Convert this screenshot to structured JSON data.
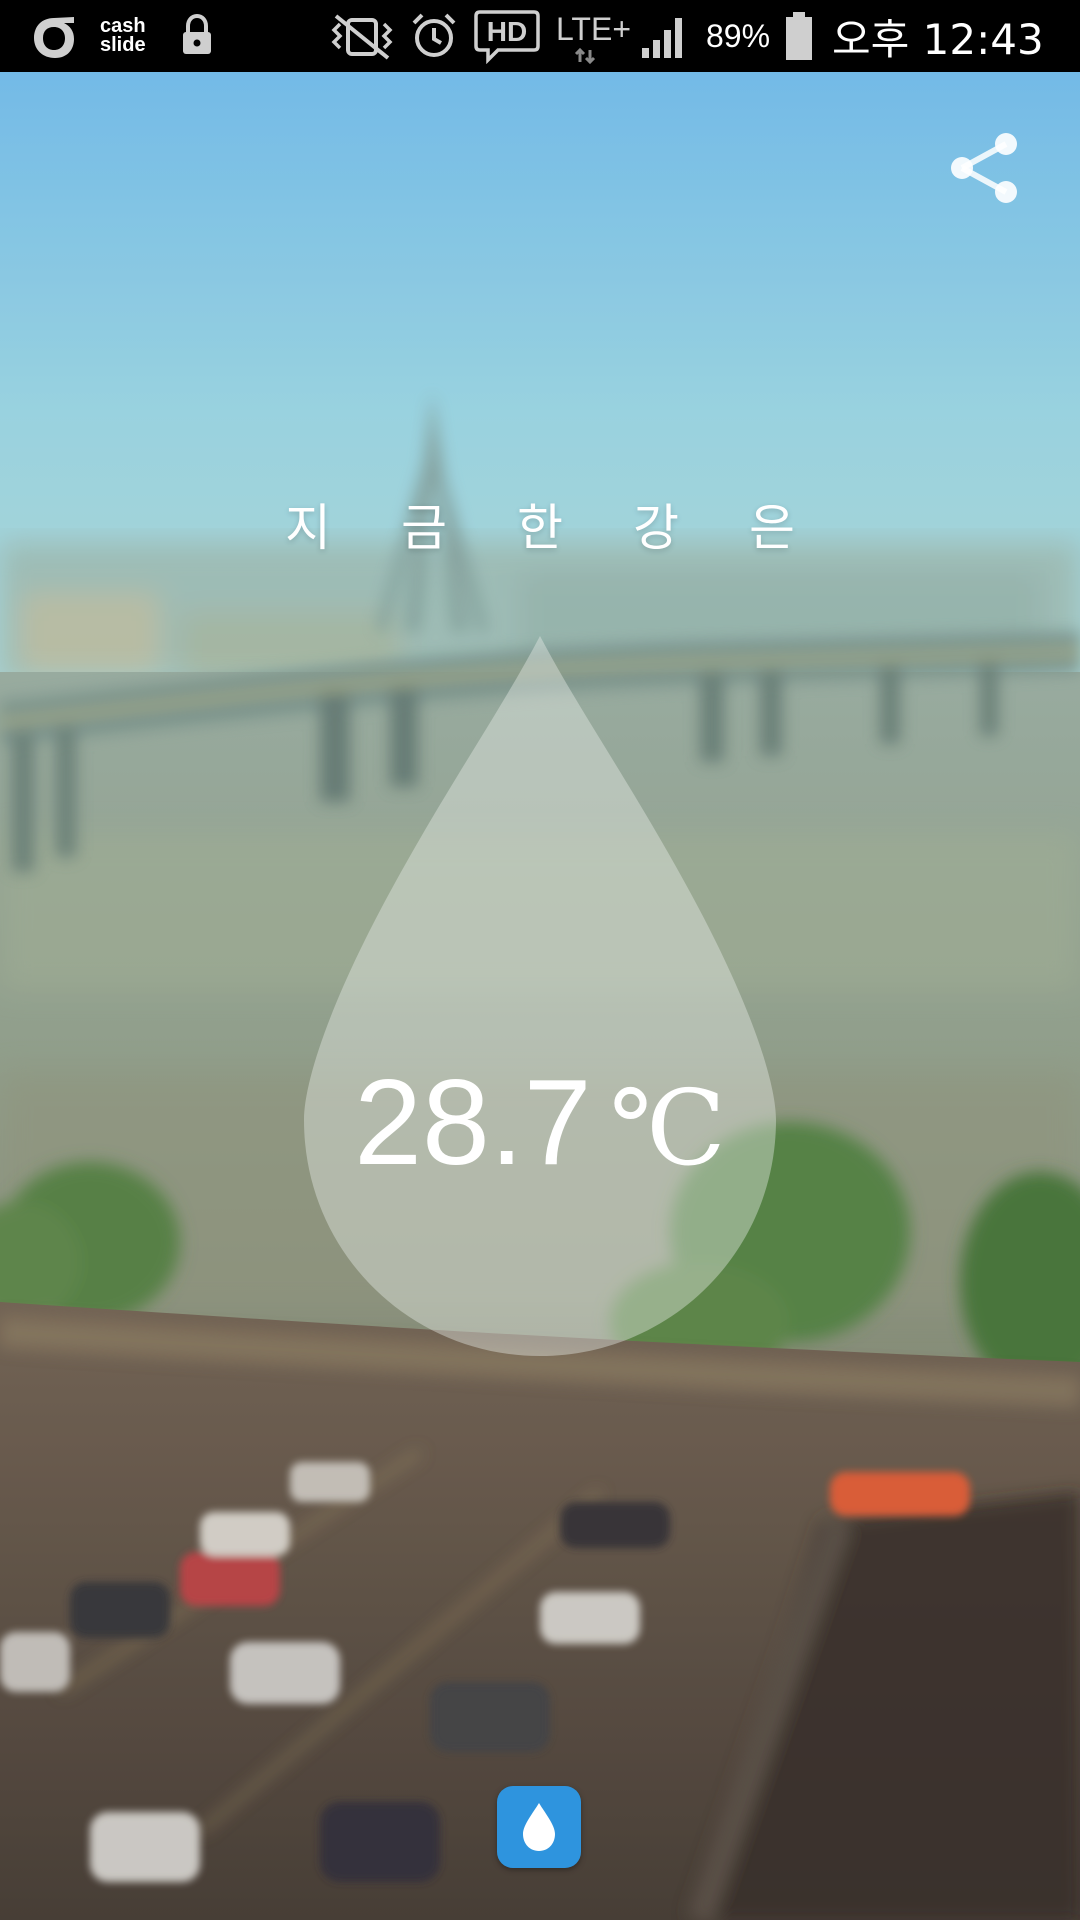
{
  "status_bar": {
    "cash_line1": "cash",
    "cash_line2": "slide",
    "hd_label": "HD",
    "network_label": "LTE+",
    "battery_percent": "89%",
    "time": "오후 12:43",
    "battery_level": 0.89
  },
  "main": {
    "headline": "지금한강은",
    "temperature_value": "28.7",
    "temperature_unit": "℃"
  },
  "icons": {
    "share": "share-icon",
    "bottom_button": "water-drop-icon"
  },
  "colors": {
    "sky_top": "#6fb9e6",
    "sky_bottom": "#9cd2d7",
    "river": "#8fa08f",
    "drop_fill": "rgba(232,236,232,0.42)",
    "accent_button": "#2e94de",
    "status_bar": "#000000",
    "text": "#ffffff"
  }
}
